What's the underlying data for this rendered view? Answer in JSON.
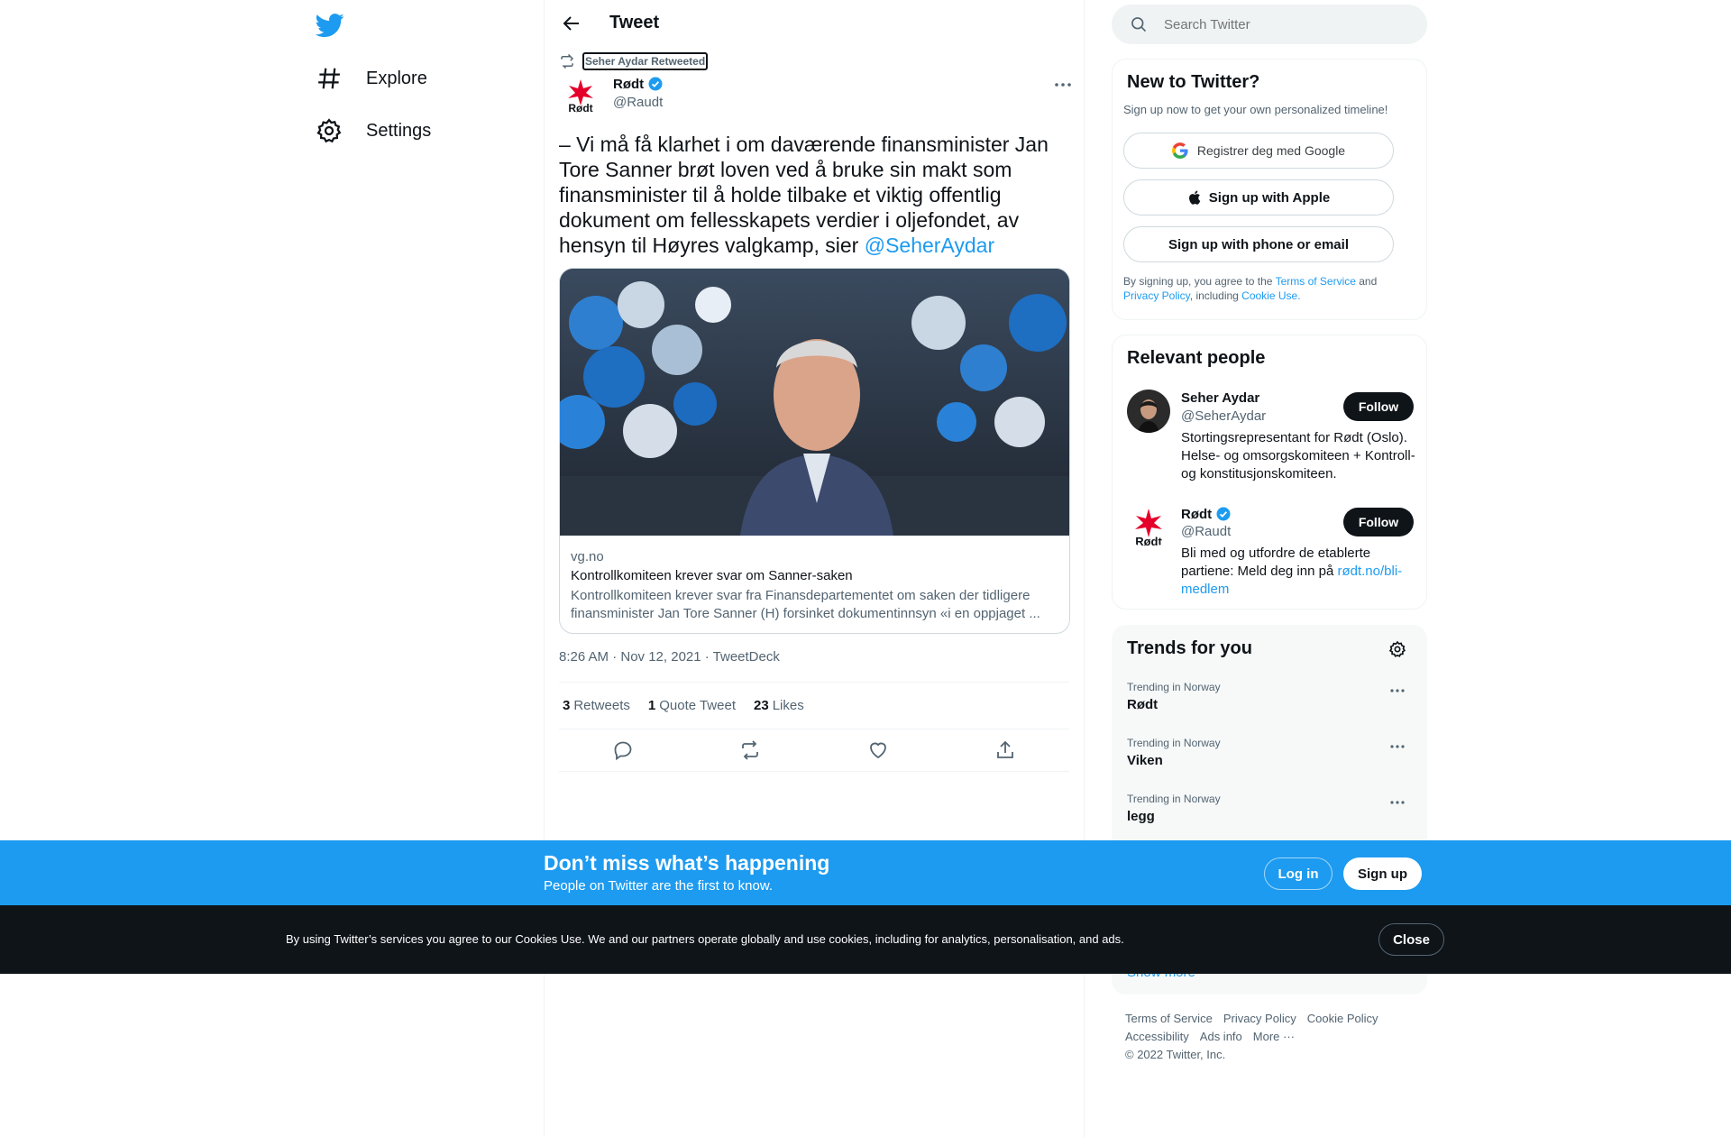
{
  "nav": {
    "items": [
      {
        "label": "Explore",
        "icon": "hashtag-icon"
      },
      {
        "label": "Settings",
        "icon": "gear-icon"
      }
    ]
  },
  "header": {
    "title": "Tweet"
  },
  "tweet": {
    "retweeted_by": "Seher Aydar Retweeted",
    "author_name": "Rødt",
    "author_handle": "@Raudt",
    "text": "– Vi må få klarhet i om daværende finansminister Jan Tore Sanner brøt loven ved å bruke sin makt som finansminister til å holde tilbake et viktig offentlig dokument om fellesskapets verdier i oljefondet, av hensyn til Høyres valgkamp, sier ",
    "mention": "@SeherAydar",
    "card": {
      "domain": "vg.no",
      "title": "Kontrollkomiteen krever svar om Sanner-saken",
      "description": "Kontrollkomiteen krever svar fra Finansdepartementet om saken der tidligere finansminister Jan Tore Sanner (H) forsinket dokumentinnsyn «i en oppjaget ..."
    },
    "timestamp": "8:26 AM · Nov 12, 2021 · TweetDeck",
    "stats": [
      {
        "count": "3",
        "label": "Retweets"
      },
      {
        "count": "1",
        "label": "Quote Tweet"
      },
      {
        "count": "23",
        "label": "Likes"
      }
    ]
  },
  "search": {
    "placeholder": "Search Twitter"
  },
  "signup_panel": {
    "title": "New to Twitter?",
    "subtitle": "Sign up now to get your own personalized timeline!",
    "google_label": "Registrer deg med Google",
    "apple_label": "Sign up with Apple",
    "phone_label": "Sign up with phone or email",
    "legal_prefix": "By signing up, you agree to the ",
    "terms": "Terms of Service",
    "and": " and ",
    "privacy": "Privacy Policy",
    "including": ", including ",
    "cookie_use": "Cookie Use."
  },
  "people_panel": {
    "title": "Relevant people",
    "people": [
      {
        "name": "Seher Aydar",
        "handle": "@SeherAydar",
        "bio": "Stortingsrepresentant for Rødt (Oslo). Helse- og omsorgskomiteen + Kontroll- og konstitusjonskomiteen.",
        "follow_label": "Follow"
      },
      {
        "name": "Rødt",
        "handle": "@Raudt",
        "bio": "Bli med og utfordre de etablerte partiene: Meld deg inn på ",
        "bio_link": "rødt.no/bli-medlem",
        "follow_label": "Follow"
      }
    ]
  },
  "trends_panel": {
    "title": "Trends for you",
    "trends": [
      {
        "context": "Trending in Norway",
        "name": "Rødt"
      },
      {
        "context": "Trending in Norway",
        "name": "Viken"
      },
      {
        "context": "Trending in Norway",
        "name": "legg"
      }
    ],
    "show_more": "Show more"
  },
  "footer": {
    "links": [
      "Terms of Service",
      "Privacy Policy",
      "Cookie Policy",
      "Accessibility",
      "Ads info",
      "More ···"
    ],
    "copyright": "© 2022 Twitter, Inc."
  },
  "signup_bar": {
    "title": "Don’t miss what’s happening",
    "subtitle": "People on Twitter are the first to know.",
    "login_label": "Log in",
    "signup_label": "Sign up"
  },
  "cookie_bar": {
    "text": "By using Twitter’s services you agree to our Cookies Use. We and our partners operate globally and use cookies, including for analytics, personalisation, and ads.",
    "close_label": "Close"
  },
  "colors": {
    "accent": "#1d9bf0",
    "text": "#0f1419",
    "secondary": "#536471",
    "cookie_bg": "#0f1419"
  }
}
